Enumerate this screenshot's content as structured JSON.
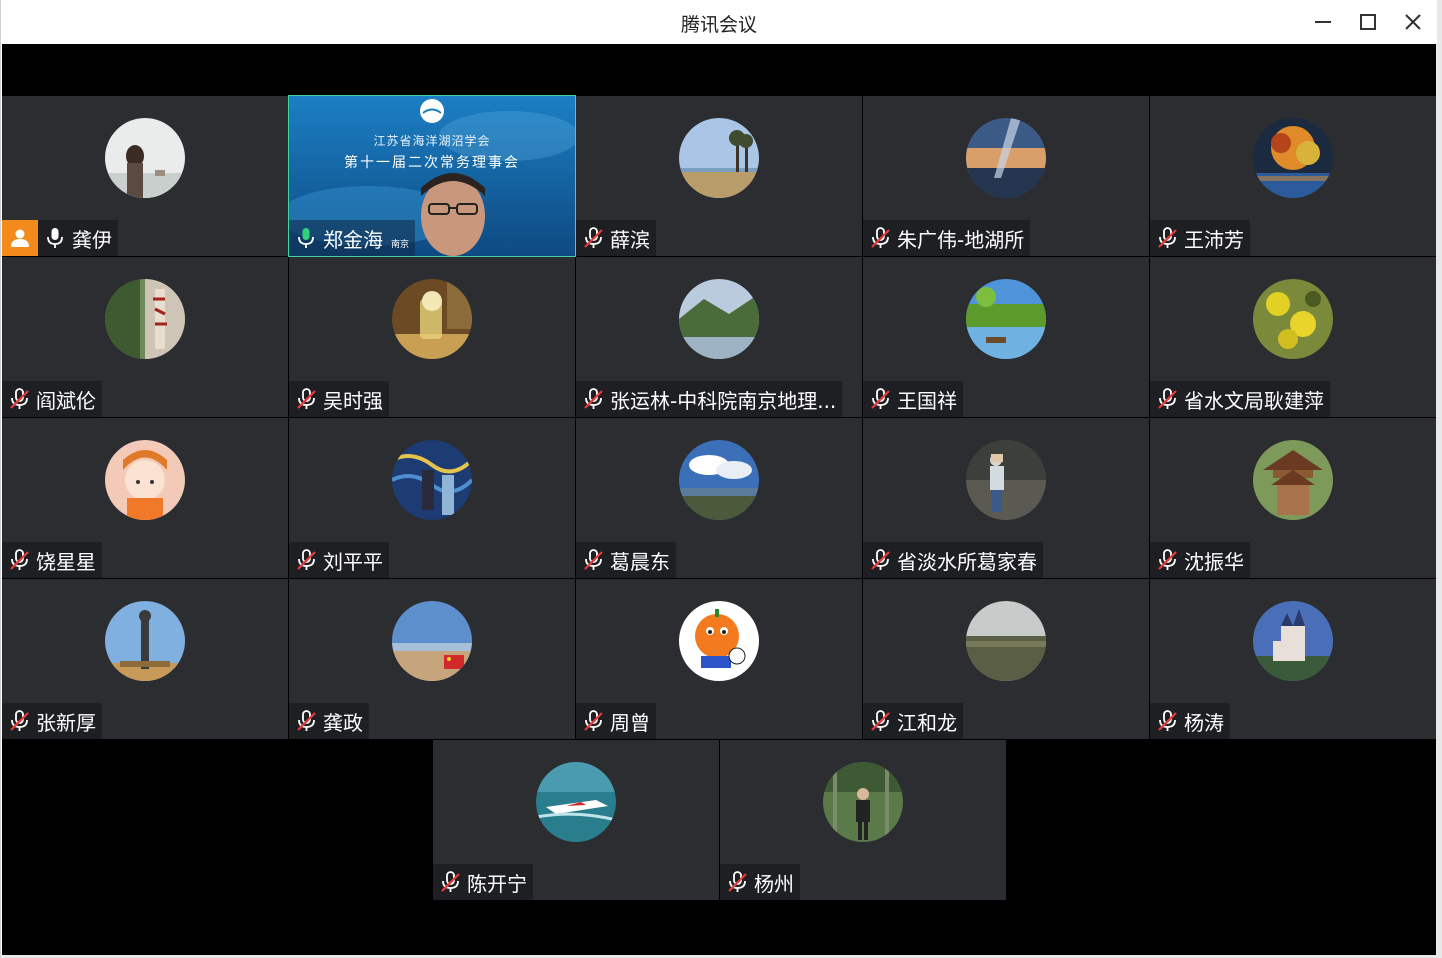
{
  "window": {
    "title": "腾讯会议"
  },
  "presenter": {
    "name": "郑金海",
    "city": "南京",
    "banner_line1": "江苏省海洋湖沼学会",
    "banner_line2": "第十一届二次常务理事会"
  },
  "participants": [
    {
      "name": "龚伊",
      "muted": false,
      "host": true
    },
    {
      "name": "郑金海",
      "muted": false,
      "video": true
    },
    {
      "name": "薛滨",
      "muted": true
    },
    {
      "name": "朱广伟-地湖所",
      "muted": true
    },
    {
      "name": "王沛芳",
      "muted": true
    },
    {
      "name": "阎斌伦",
      "muted": true
    },
    {
      "name": "吴时强",
      "muted": true
    },
    {
      "name": "张运林-中科院南京地理...",
      "muted": true
    },
    {
      "name": "王国祥",
      "muted": true
    },
    {
      "name": "省水文局耿建萍",
      "muted": true
    },
    {
      "name": "饶星星",
      "muted": true
    },
    {
      "name": "刘平平",
      "muted": true
    },
    {
      "name": "葛晨东",
      "muted": true
    },
    {
      "name": "省淡水所葛家春",
      "muted": true
    },
    {
      "name": "沈振华",
      "muted": true
    },
    {
      "name": "张新厚",
      "muted": true
    },
    {
      "name": "龚政",
      "muted": true
    },
    {
      "name": "周曾",
      "muted": true
    },
    {
      "name": "江和龙",
      "muted": true
    },
    {
      "name": "杨涛",
      "muted": true
    },
    {
      "name": "陈开宁",
      "muted": true
    },
    {
      "name": "杨州",
      "muted": true
    }
  ],
  "colors": {
    "tile_bg": "#2b2d31",
    "label_bg": "#1d1f22",
    "host_badge": "#f38b1c",
    "mic_active": "#2fd27a",
    "stage_bg": "#000000"
  }
}
